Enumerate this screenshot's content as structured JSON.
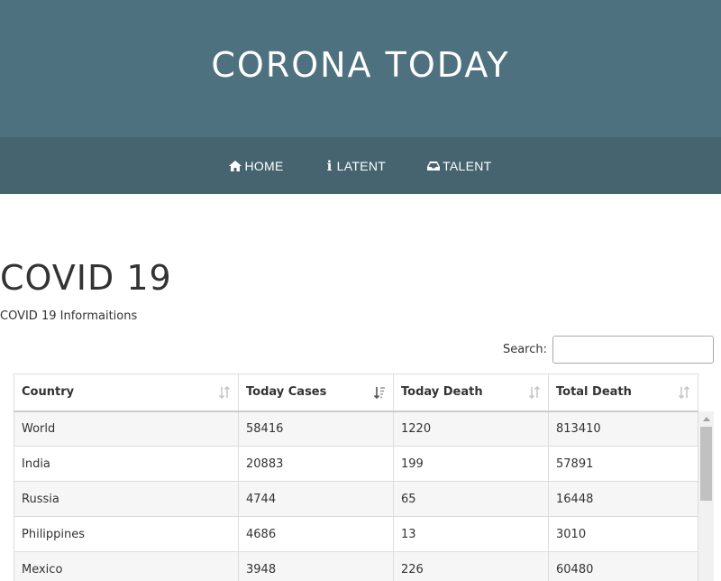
{
  "header": {
    "title": "CORONA TODAY"
  },
  "nav": {
    "items": [
      {
        "label": "HOME",
        "icon": "home-icon"
      },
      {
        "label": "LATENT",
        "icon": "info-icon"
      },
      {
        "label": "TALENT",
        "icon": "inbox-icon"
      }
    ]
  },
  "main": {
    "title": "COVID 19",
    "subtitle": "COVID 19 Informaitions",
    "search": {
      "label": "Search:",
      "value": "",
      "placeholder": ""
    }
  },
  "table": {
    "columns": [
      "Country",
      "Today Cases",
      "Today Death",
      "Total Death"
    ],
    "sorted_column": "Today Cases",
    "sort_direction": "descending",
    "rows": [
      [
        "World",
        "58416",
        "1220",
        "813410"
      ],
      [
        "India",
        "20883",
        "199",
        "57891"
      ],
      [
        "Russia",
        "4744",
        "65",
        "16448"
      ],
      [
        "Philippines",
        "4686",
        "13",
        "3010"
      ],
      [
        "Mexico",
        "3948",
        "226",
        "60480"
      ]
    ]
  },
  "colors": {
    "header_bg": "#4e717f",
    "nav_bg": "#46646f",
    "text": "#333333"
  }
}
